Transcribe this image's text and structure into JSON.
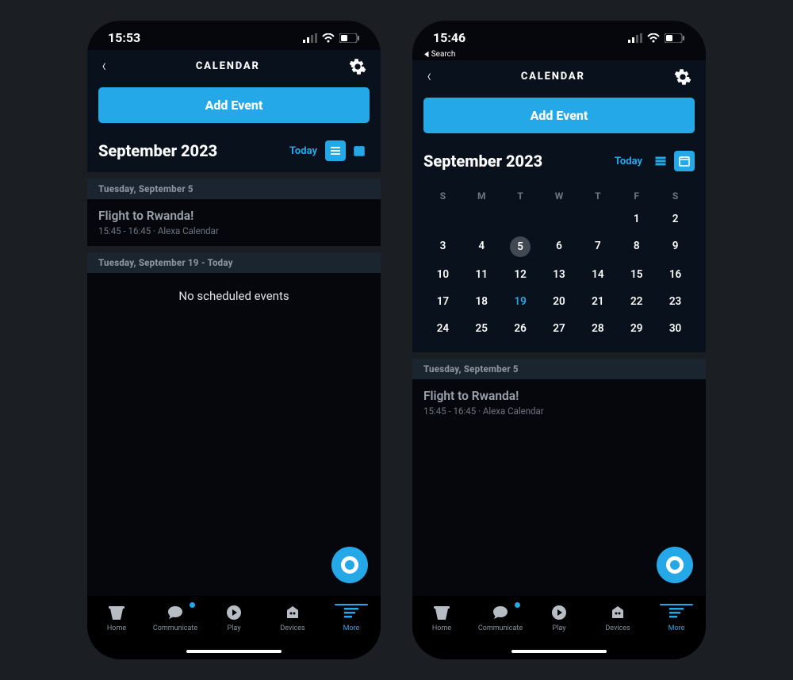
{
  "left": {
    "status": {
      "time": "15:53"
    },
    "header": {
      "title": "CALENDAR"
    },
    "add_button": "Add Event",
    "month": "September 2023",
    "today_label": "Today",
    "sections": [
      {
        "label": "Tuesday, September 5",
        "events": [
          {
            "title": "Flight to Rwanda!",
            "meta": "15:45 - 16:45 · Alexa Calendar"
          }
        ]
      },
      {
        "label": "Tuesday, September 19 - Today",
        "empty": "No scheduled events"
      }
    ]
  },
  "right": {
    "status": {
      "time": "15:46"
    },
    "crumb": "Search",
    "header": {
      "title": "CALENDAR"
    },
    "add_button": "Add Event",
    "month": "September 2023",
    "today_label": "Today",
    "calendar": {
      "dow": [
        "S",
        "M",
        "T",
        "W",
        "T",
        "F",
        "S"
      ],
      "days": [
        "",
        "",
        "",
        "",
        "",
        "1",
        "2",
        "3",
        "4",
        "5",
        "6",
        "7",
        "8",
        "9",
        "10",
        "11",
        "12",
        "13",
        "14",
        "15",
        "16",
        "17",
        "18",
        "19",
        "20",
        "21",
        "22",
        "23",
        "24",
        "25",
        "26",
        "27",
        "28",
        "29",
        "30"
      ],
      "selected_index": 9,
      "today_index": 23
    },
    "sections": [
      {
        "label": "Tuesday, September 5",
        "events": [
          {
            "title": "Flight to Rwanda!",
            "meta": "15:45 - 16:45 · Alexa Calendar"
          }
        ]
      }
    ]
  },
  "tabbar": [
    "Home",
    "Communicate",
    "Play",
    "Devices",
    "More"
  ]
}
